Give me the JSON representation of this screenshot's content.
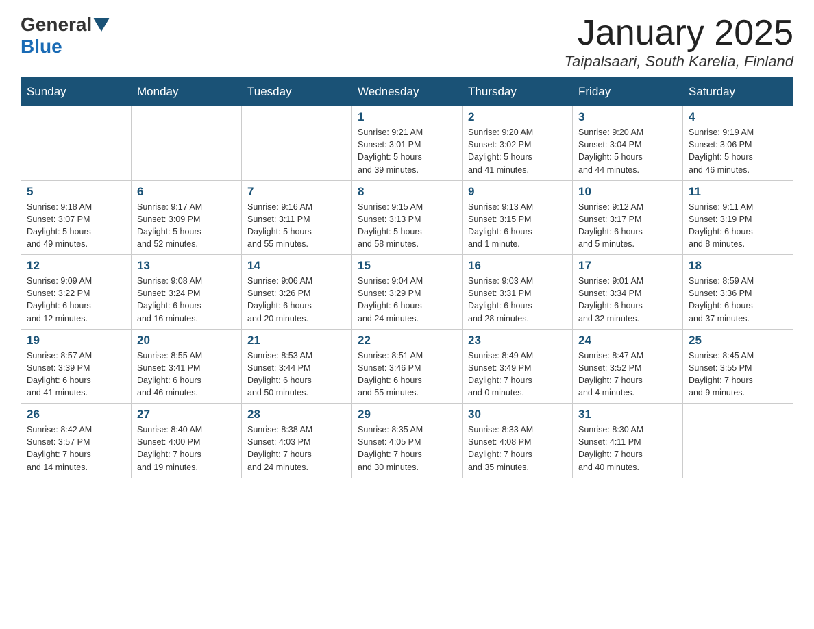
{
  "header": {
    "logo": {
      "general": "General",
      "blue": "Blue"
    },
    "title": "January 2025",
    "location": "Taipalsaari, South Karelia, Finland"
  },
  "weekdays": [
    "Sunday",
    "Monday",
    "Tuesday",
    "Wednesday",
    "Thursday",
    "Friday",
    "Saturday"
  ],
  "weeks": [
    [
      {
        "day": "",
        "info": ""
      },
      {
        "day": "",
        "info": ""
      },
      {
        "day": "",
        "info": ""
      },
      {
        "day": "1",
        "info": "Sunrise: 9:21 AM\nSunset: 3:01 PM\nDaylight: 5 hours\nand 39 minutes."
      },
      {
        "day": "2",
        "info": "Sunrise: 9:20 AM\nSunset: 3:02 PM\nDaylight: 5 hours\nand 41 minutes."
      },
      {
        "day": "3",
        "info": "Sunrise: 9:20 AM\nSunset: 3:04 PM\nDaylight: 5 hours\nand 44 minutes."
      },
      {
        "day": "4",
        "info": "Sunrise: 9:19 AM\nSunset: 3:06 PM\nDaylight: 5 hours\nand 46 minutes."
      }
    ],
    [
      {
        "day": "5",
        "info": "Sunrise: 9:18 AM\nSunset: 3:07 PM\nDaylight: 5 hours\nand 49 minutes."
      },
      {
        "day": "6",
        "info": "Sunrise: 9:17 AM\nSunset: 3:09 PM\nDaylight: 5 hours\nand 52 minutes."
      },
      {
        "day": "7",
        "info": "Sunrise: 9:16 AM\nSunset: 3:11 PM\nDaylight: 5 hours\nand 55 minutes."
      },
      {
        "day": "8",
        "info": "Sunrise: 9:15 AM\nSunset: 3:13 PM\nDaylight: 5 hours\nand 58 minutes."
      },
      {
        "day": "9",
        "info": "Sunrise: 9:13 AM\nSunset: 3:15 PM\nDaylight: 6 hours\nand 1 minute."
      },
      {
        "day": "10",
        "info": "Sunrise: 9:12 AM\nSunset: 3:17 PM\nDaylight: 6 hours\nand 5 minutes."
      },
      {
        "day": "11",
        "info": "Sunrise: 9:11 AM\nSunset: 3:19 PM\nDaylight: 6 hours\nand 8 minutes."
      }
    ],
    [
      {
        "day": "12",
        "info": "Sunrise: 9:09 AM\nSunset: 3:22 PM\nDaylight: 6 hours\nand 12 minutes."
      },
      {
        "day": "13",
        "info": "Sunrise: 9:08 AM\nSunset: 3:24 PM\nDaylight: 6 hours\nand 16 minutes."
      },
      {
        "day": "14",
        "info": "Sunrise: 9:06 AM\nSunset: 3:26 PM\nDaylight: 6 hours\nand 20 minutes."
      },
      {
        "day": "15",
        "info": "Sunrise: 9:04 AM\nSunset: 3:29 PM\nDaylight: 6 hours\nand 24 minutes."
      },
      {
        "day": "16",
        "info": "Sunrise: 9:03 AM\nSunset: 3:31 PM\nDaylight: 6 hours\nand 28 minutes."
      },
      {
        "day": "17",
        "info": "Sunrise: 9:01 AM\nSunset: 3:34 PM\nDaylight: 6 hours\nand 32 minutes."
      },
      {
        "day": "18",
        "info": "Sunrise: 8:59 AM\nSunset: 3:36 PM\nDaylight: 6 hours\nand 37 minutes."
      }
    ],
    [
      {
        "day": "19",
        "info": "Sunrise: 8:57 AM\nSunset: 3:39 PM\nDaylight: 6 hours\nand 41 minutes."
      },
      {
        "day": "20",
        "info": "Sunrise: 8:55 AM\nSunset: 3:41 PM\nDaylight: 6 hours\nand 46 minutes."
      },
      {
        "day": "21",
        "info": "Sunrise: 8:53 AM\nSunset: 3:44 PM\nDaylight: 6 hours\nand 50 minutes."
      },
      {
        "day": "22",
        "info": "Sunrise: 8:51 AM\nSunset: 3:46 PM\nDaylight: 6 hours\nand 55 minutes."
      },
      {
        "day": "23",
        "info": "Sunrise: 8:49 AM\nSunset: 3:49 PM\nDaylight: 7 hours\nand 0 minutes."
      },
      {
        "day": "24",
        "info": "Sunrise: 8:47 AM\nSunset: 3:52 PM\nDaylight: 7 hours\nand 4 minutes."
      },
      {
        "day": "25",
        "info": "Sunrise: 8:45 AM\nSunset: 3:55 PM\nDaylight: 7 hours\nand 9 minutes."
      }
    ],
    [
      {
        "day": "26",
        "info": "Sunrise: 8:42 AM\nSunset: 3:57 PM\nDaylight: 7 hours\nand 14 minutes."
      },
      {
        "day": "27",
        "info": "Sunrise: 8:40 AM\nSunset: 4:00 PM\nDaylight: 7 hours\nand 19 minutes."
      },
      {
        "day": "28",
        "info": "Sunrise: 8:38 AM\nSunset: 4:03 PM\nDaylight: 7 hours\nand 24 minutes."
      },
      {
        "day": "29",
        "info": "Sunrise: 8:35 AM\nSunset: 4:05 PM\nDaylight: 7 hours\nand 30 minutes."
      },
      {
        "day": "30",
        "info": "Sunrise: 8:33 AM\nSunset: 4:08 PM\nDaylight: 7 hours\nand 35 minutes."
      },
      {
        "day": "31",
        "info": "Sunrise: 8:30 AM\nSunset: 4:11 PM\nDaylight: 7 hours\nand 40 minutes."
      },
      {
        "day": "",
        "info": ""
      }
    ]
  ]
}
